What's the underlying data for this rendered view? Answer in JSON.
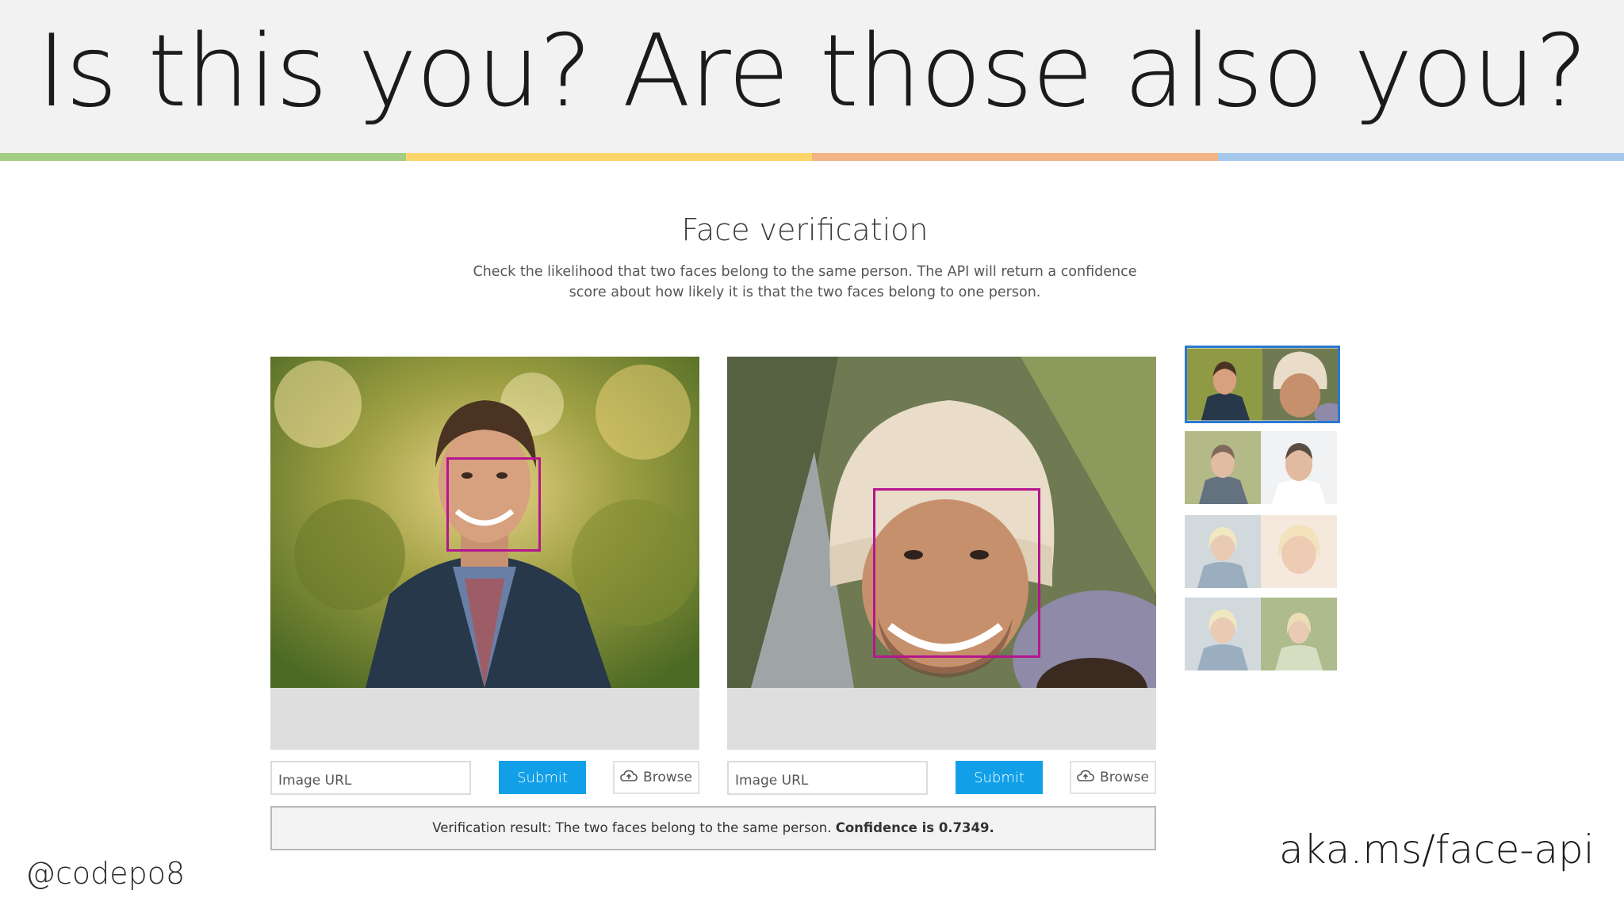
{
  "slide": {
    "title": "Is this you? Are those also you?",
    "handle": "@codepo8",
    "link": "aka.ms/face-api",
    "bar_colors": [
      "#a3cd83",
      "#fbd46a",
      "#f2b385",
      "#a6c7ec"
    ]
  },
  "app": {
    "title": "Face verification",
    "description": "Check the likelihood that two faces belong to the same person. The API will return a confidence score about how likely it is that the two faces belong to one person.",
    "accent": "#11a0e8",
    "face_box_color": "#b4168f",
    "left_panel": {
      "url_placeholder": "Image URL",
      "submit_label": "Submit",
      "browse_label": "Browse",
      "browse_icon": "cloud-upload-icon"
    },
    "right_panel": {
      "url_placeholder": "Image URL",
      "submit_label": "Submit",
      "browse_label": "Browse",
      "browse_icon": "cloud-upload-icon"
    },
    "result": {
      "text": "Verification result: The two faces belong to the same person.",
      "confidence_label": "Confidence is 0.7349."
    },
    "sample_pairs_count_selected_index": 0
  }
}
